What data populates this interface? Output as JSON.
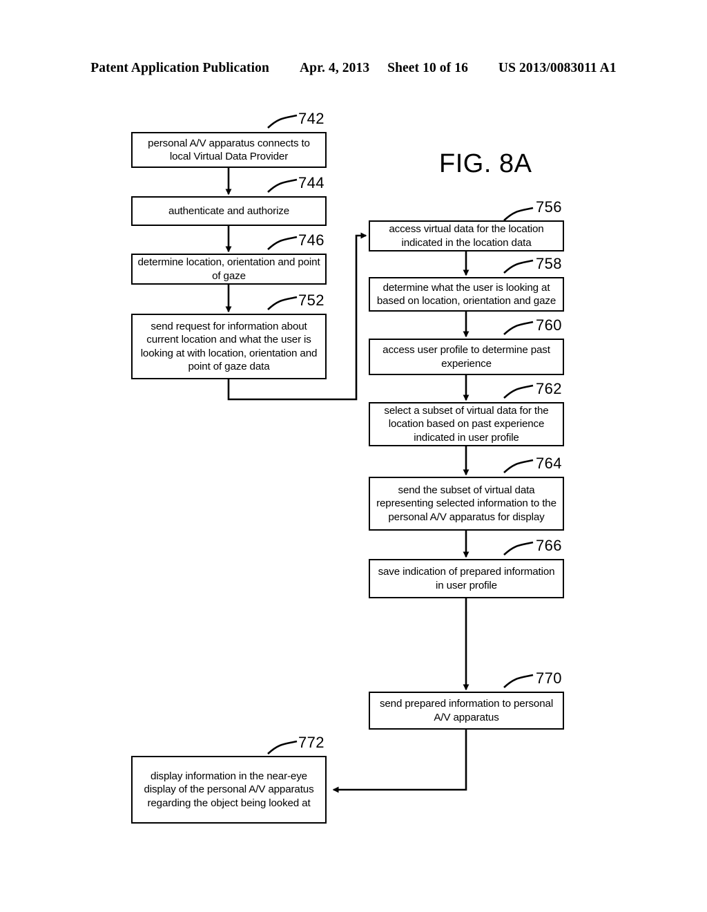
{
  "header": {
    "publication": "Patent Application Publication",
    "date": "Apr. 4, 2013",
    "sheet": "Sheet 10 of 16",
    "docnum": "US 2013/0083011 A1"
  },
  "figure": {
    "label": "FIG. 8A"
  },
  "flowchart": {
    "nodes": [
      {
        "id": "742",
        "ref": "742",
        "text": "personal A/V apparatus connects to local Virtual Data Provider"
      },
      {
        "id": "744",
        "ref": "744",
        "text": "authenticate and authorize"
      },
      {
        "id": "746",
        "ref": "746",
        "text": "determine location, orientation and point of gaze"
      },
      {
        "id": "752",
        "ref": "752",
        "text": "send request for information about current location and what the user is looking at with location, orientation and point of gaze data"
      },
      {
        "id": "756",
        "ref": "756",
        "text": "access virtual data for the location indicated in the location data"
      },
      {
        "id": "758",
        "ref": "758",
        "text": "determine what the user is looking at based on location, orientation and gaze"
      },
      {
        "id": "760",
        "ref": "760",
        "text": "access user profile to determine past experience"
      },
      {
        "id": "762",
        "ref": "762",
        "text": "select a subset of virtual data for the location based on past experience indicated in user profile"
      },
      {
        "id": "764",
        "ref": "764",
        "text": "send the subset of virtual data representing selected information to the personal A/V apparatus for display"
      },
      {
        "id": "766",
        "ref": "766",
        "text": "save indication of prepared information in user profile"
      },
      {
        "id": "770",
        "ref": "770",
        "text": "send prepared information to personal A/V apparatus"
      },
      {
        "id": "772",
        "ref": "772",
        "text": "display information in the near-eye display of the personal A/V apparatus regarding the object being looked at"
      }
    ],
    "edges": [
      {
        "from": "742",
        "to": "744"
      },
      {
        "from": "744",
        "to": "746"
      },
      {
        "from": "746",
        "to": "752"
      },
      {
        "from": "752",
        "to": "756"
      },
      {
        "from": "756",
        "to": "758"
      },
      {
        "from": "758",
        "to": "760"
      },
      {
        "from": "760",
        "to": "762"
      },
      {
        "from": "762",
        "to": "764"
      },
      {
        "from": "764",
        "to": "766"
      },
      {
        "from": "766",
        "to": "770"
      },
      {
        "from": "770",
        "to": "772"
      }
    ]
  }
}
